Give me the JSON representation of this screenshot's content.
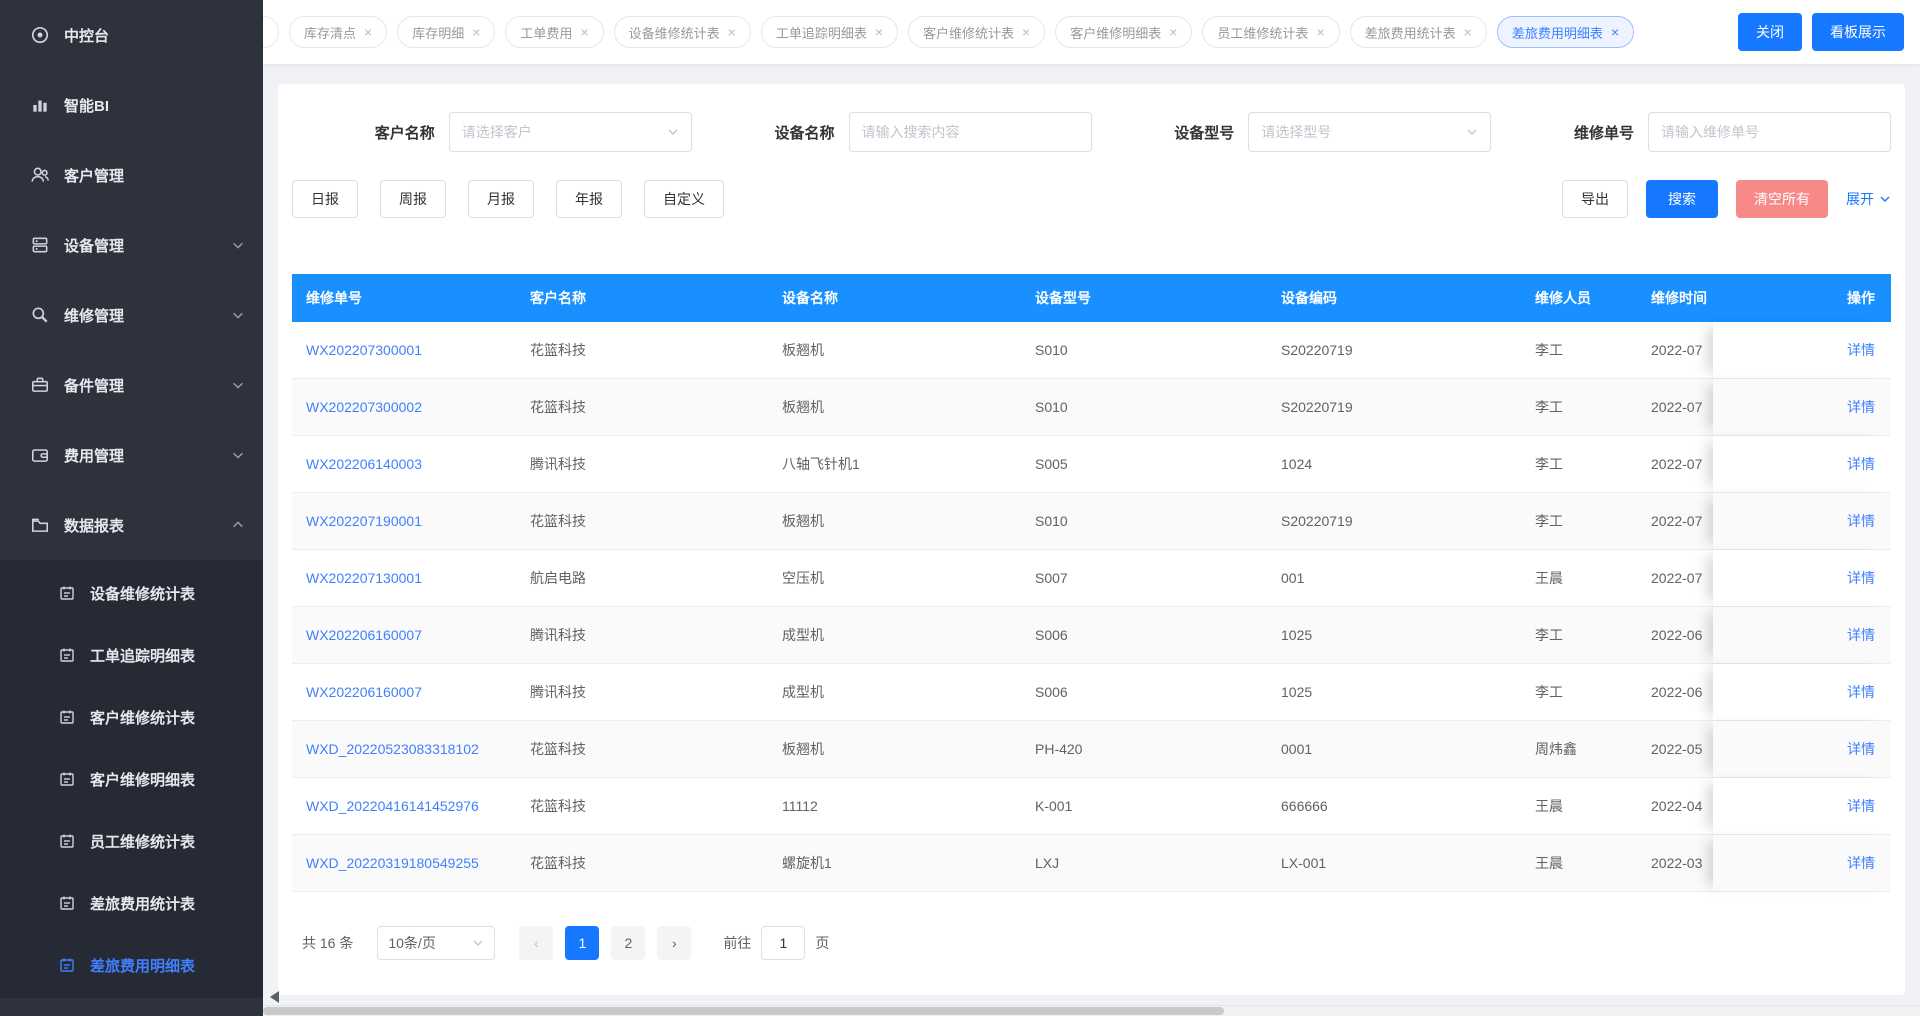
{
  "colors": {
    "accent": "#1677ff",
    "table_header": "#1890ff",
    "danger": "#f78989",
    "link": "#4080ff",
    "sidebar_bg": "#2e323c",
    "submenu_bg": "#262a34",
    "content_bg": "#f0f2f5"
  },
  "sidebar": {
    "items": [
      {
        "label": "中控台",
        "icon": "console-icon"
      },
      {
        "label": "智能BI",
        "icon": "bi-chart-icon"
      },
      {
        "label": "客户管理",
        "icon": "customers-icon"
      },
      {
        "label": "设备管理",
        "icon": "devices-icon",
        "expandable": true
      },
      {
        "label": "维修管理",
        "icon": "repair-icon",
        "expandable": true
      },
      {
        "label": "备件管理",
        "icon": "spare-parts-icon",
        "expandable": true
      },
      {
        "label": "费用管理",
        "icon": "expenses-icon",
        "expandable": true
      },
      {
        "label": "数据报表",
        "icon": "reports-icon",
        "expandable": true,
        "expanded": true
      }
    ],
    "subitems": [
      {
        "label": "设备维修统计表"
      },
      {
        "label": "工单追踪明细表"
      },
      {
        "label": "客户维修统计表"
      },
      {
        "label": "客户维修明细表"
      },
      {
        "label": "员工维修统计表"
      },
      {
        "label": "差旅费用统计表"
      },
      {
        "label": "差旅费用明细表",
        "active": true
      }
    ]
  },
  "tabbar": {
    "tabs": [
      {
        "label": "库存清点"
      },
      {
        "label": "库存明细"
      },
      {
        "label": "工单费用"
      },
      {
        "label": "设备维修统计表"
      },
      {
        "label": "工单追踪明细表"
      },
      {
        "label": "客户维修统计表"
      },
      {
        "label": "客户维修明细表"
      },
      {
        "label": "员工维修统计表"
      },
      {
        "label": "差旅费用统计表"
      },
      {
        "label": "差旅费用明细表",
        "active": true
      }
    ],
    "close_button": "关闭",
    "board_button": "看板展示"
  },
  "filters": {
    "customer_label": "客户名称",
    "customer_placeholder": "请选择客户",
    "device_label": "设备名称",
    "device_placeholder": "请输入搜索内容",
    "model_label": "设备型号",
    "model_placeholder": "请选择型号",
    "order_label": "维修单号",
    "order_placeholder": "请输入维修单号",
    "period_buttons": [
      "日报",
      "周报",
      "月报",
      "年报",
      "自定义"
    ],
    "export_button": "导出",
    "search_button": "搜索",
    "clear_button": "清空所有",
    "expand_link": "展开"
  },
  "table": {
    "headers": [
      "维修单号",
      "客户名称",
      "设备名称",
      "设备型号",
      "设备编码",
      "维修人员",
      "维修时间",
      "操作"
    ],
    "action_label": "详情",
    "rows": [
      {
        "order_no": "WX202207300001",
        "customer": "花篮科技",
        "device": "板翘机",
        "model": "S010",
        "code": "S20220719",
        "worker": "李工",
        "time": "2022-07"
      },
      {
        "order_no": "WX202207300002",
        "customer": "花篮科技",
        "device": "板翘机",
        "model": "S010",
        "code": "S20220719",
        "worker": "李工",
        "time": "2022-07"
      },
      {
        "order_no": "WX202206140003",
        "customer": "腾讯科技",
        "device": "八轴飞针机1",
        "model": "S005",
        "code": "1024",
        "worker": "李工",
        "time": "2022-07"
      },
      {
        "order_no": "WX202207190001",
        "customer": "花篮科技",
        "device": "板翘机",
        "model": "S010",
        "code": "S20220719",
        "worker": "李工",
        "time": "2022-07"
      },
      {
        "order_no": "WX202207130001",
        "customer": "航启电路",
        "device": "空压机",
        "model": "S007",
        "code": "001",
        "worker": "王晨",
        "time": "2022-07"
      },
      {
        "order_no": "WX202206160007",
        "customer": "腾讯科技",
        "device": "成型机",
        "model": "S006",
        "code": "1025",
        "worker": "李工",
        "time": "2022-06"
      },
      {
        "order_no": "WX202206160007",
        "customer": "腾讯科技",
        "device": "成型机",
        "model": "S006",
        "code": "1025",
        "worker": "李工",
        "time": "2022-06"
      },
      {
        "order_no": "WXD_20220523083318102",
        "customer": "花篮科技",
        "device": "板翘机",
        "model": "PH-420",
        "code": "0001",
        "worker": "周炜鑫",
        "time": "2022-05"
      },
      {
        "order_no": "WXD_20220416141452976",
        "customer": "花篮科技",
        "device": "11112",
        "model": "K-001",
        "code": "666666",
        "worker": "王晨",
        "time": "2022-04"
      },
      {
        "order_no": "WXD_20220319180549255",
        "customer": "花篮科技",
        "device": "螺旋机1",
        "model": "LXJ",
        "code": "LX-001",
        "worker": "王晨",
        "time": "2022-03"
      }
    ]
  },
  "pagination": {
    "total_text": "共 16 条",
    "page_size": "10条/页",
    "prev_icon": "‹",
    "next_icon": "›",
    "pages": [
      {
        "label": "1",
        "active": true
      },
      {
        "label": "2"
      }
    ],
    "goto_label": "前往",
    "goto_value": "1",
    "goto_suffix": "页"
  }
}
